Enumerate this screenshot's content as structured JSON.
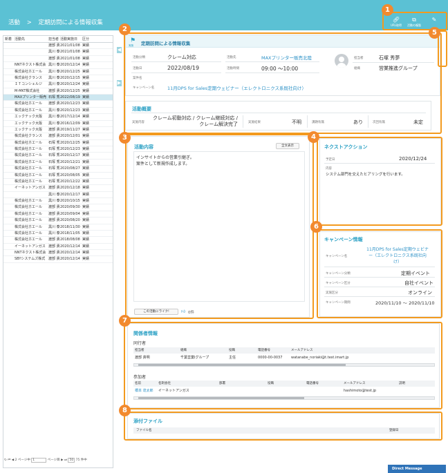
{
  "header": {
    "breadcrumb_root": "活動",
    "breadcrumb_sep": ">",
    "breadcrumb_current": "定期訪問による情報収集"
  },
  "toolbar": {
    "buttons": [
      {
        "label": "URL取得",
        "icon": "link-icon"
      },
      {
        "label": "活動の複製",
        "icon": "copy-icon"
      },
      {
        "label": "",
        "icon": "edit-icon"
      }
    ]
  },
  "callouts": [
    "1",
    "2",
    "3",
    "4",
    "5",
    "6",
    "7",
    "8"
  ],
  "list": {
    "headers": [
      "新着",
      "活動先",
      "担当者",
      "活動実施日",
      "区分"
    ],
    "rows": [
      {
        "new": "",
        "name": "",
        "person": "渡部 貴",
        "date": "2021/01/08",
        "kind": "実績"
      },
      {
        "new": "",
        "name": "",
        "person": "黒川 泰",
        "date": "2021/01/08",
        "kind": "実績"
      },
      {
        "new": "",
        "name": "",
        "person": "渡部 貴",
        "date": "2021/01/08",
        "kind": "実績"
      },
      {
        "new": "",
        "name": "NNTネクスト株式会",
        "person": "黒川 泰",
        "date": "2020/12/14",
        "kind": "実績"
      },
      {
        "new": "",
        "name": "株式会社ホエール",
        "person": "黒川 泰",
        "date": "2020/12/25",
        "kind": "実績"
      },
      {
        "new": "",
        "name": "株式会社クランス",
        "person": "黒川 泰",
        "date": "2020/12/15",
        "kind": "実績"
      },
      {
        "new": "",
        "name": "ＩＴコンシェルジ",
        "person": "黒川 泰",
        "date": "2020/12/24",
        "kind": "実績"
      },
      {
        "new": "",
        "name": "M-MKT株式会社",
        "person": "渡部 貴",
        "date": "2020/12/25",
        "kind": "実績"
      },
      {
        "new": "",
        "name": "MAXプリンター販売",
        "person": "石塚 秀",
        "date": "2022/08/19",
        "kind": "実績"
      },
      {
        "new": "",
        "name": "株式会社ホエール",
        "person": "渡部 貴",
        "date": "2020/12/23",
        "kind": "実績"
      },
      {
        "new": "",
        "name": "株式会社ホエール",
        "person": "黒川 泰",
        "date": "2020/12/23",
        "kind": "実績"
      },
      {
        "new": "",
        "name": "エックテック大阪",
        "person": "黒川 泰",
        "date": "2017/12/14",
        "kind": "実績"
      },
      {
        "new": "",
        "name": "エックテック大阪",
        "person": "黒川 泰",
        "date": "2016/12/09",
        "kind": "実績"
      },
      {
        "new": "",
        "name": "エックテック大阪",
        "person": "渡部 貴",
        "date": "2019/11/27",
        "kind": "実績"
      },
      {
        "new": "",
        "name": "株式会社クランス",
        "person": "渡部 貴",
        "date": "2020/12/01",
        "kind": "実績"
      },
      {
        "new": "",
        "name": "株式会社ホエール",
        "person": "石塚 秀",
        "date": "2020/12/25",
        "kind": "実績"
      },
      {
        "new": "",
        "name": "株式会社ホエール",
        "person": "石塚 秀",
        "date": "2020/12/23",
        "kind": "実績"
      },
      {
        "new": "",
        "name": "株式会社ホエール",
        "person": "石塚 秀",
        "date": "2020/12/17",
        "kind": "実績"
      },
      {
        "new": "",
        "name": "株式会社ホエール",
        "person": "石塚 秀",
        "date": "2020/12/21",
        "kind": "実績"
      },
      {
        "new": "",
        "name": "株式会社ホエール",
        "person": "石塚 秀",
        "date": "2020/08/27",
        "kind": "実績"
      },
      {
        "new": "",
        "name": "株式会社ホエール",
        "person": "石塚 秀",
        "date": "2020/08/05",
        "kind": "実績"
      },
      {
        "new": "",
        "name": "株式会社ホエール",
        "person": "石塚 秀",
        "date": "2020/12/22",
        "kind": "実績"
      },
      {
        "new": "",
        "name": "イーネットアンガス",
        "person": "渡部 貴",
        "date": "2020/12/18",
        "kind": "実績"
      },
      {
        "new": "",
        "name": "",
        "person": "黒川 泰",
        "date": "2020/12/17",
        "kind": "実績"
      },
      {
        "new": "",
        "name": "株式会社ホエール",
        "person": "黒川 泰",
        "date": "2020/10/15",
        "kind": "実績"
      },
      {
        "new": "",
        "name": "株式会社ホエール",
        "person": "渡部 貴",
        "date": "2020/09/30",
        "kind": "実績"
      },
      {
        "new": "",
        "name": "株式会社ホエール",
        "person": "渡部 貴",
        "date": "2020/09/04",
        "kind": "実績"
      },
      {
        "new": "",
        "name": "株式会社ホエール",
        "person": "渡部 貴",
        "date": "2020/08/20",
        "kind": "実績"
      },
      {
        "new": "",
        "name": "株式会社ホエール",
        "person": "黒川 泰",
        "date": "2018/11/30",
        "kind": "実績"
      },
      {
        "new": "",
        "name": "株式会社ホエール",
        "person": "黒川 泰",
        "date": "2018/11/05",
        "kind": "実績"
      },
      {
        "new": "",
        "name": "株式会社ホエール",
        "person": "渡部 貴",
        "date": "2018/08/08",
        "kind": "実績"
      },
      {
        "new": "",
        "name": "イーネットアンガス",
        "person": "渡部 貴",
        "date": "2020/12/14",
        "kind": "実績"
      },
      {
        "new": "",
        "name": "NNTネクスト株式会",
        "person": "渡部 貴",
        "date": "2020/12/14",
        "kind": "実績"
      },
      {
        "new": "",
        "name": "SBYシステムズ株式",
        "person": "渡部 貴",
        "date": "2020/12/14",
        "kind": "実績"
      }
    ],
    "selected_index": 8,
    "pager": {
      "first": "⏮",
      "prev": "◀",
      "page_label": "2 ページ中",
      "page_value": "1",
      "page_suffix": "ページ目",
      "next": "▶",
      "last": "⏭",
      "per_page": "50",
      "count_text": "75 件中"
    }
  },
  "activity": {
    "flag_label": "実施",
    "title": "定期訪問による情報収集",
    "fields": {
      "type_label": "活動分類",
      "type_value": "クレーム対応",
      "date_label": "活動日",
      "date_value": "2022/08/19",
      "subject_label": "案件名",
      "subject_value": "",
      "campaign_label": "キャンペーン名",
      "campaign_value": "11月DPS for Sales定期ウェビナー（エレクトロニクス系既社向け）",
      "dest_label": "活動先",
      "dest_value": "MAXプリンター販売北陸",
      "time_label": "活動時間",
      "time_value": "09:00 〜10:00",
      "owner_label": "担当者",
      "owner_value": "石塚 秀夢",
      "org_label": "組織",
      "org_value": "営業推進グループ"
    }
  },
  "summary": {
    "title": "活動概要",
    "content_label": "実施内容",
    "content_value": [
      "クレーム初動対応 / クレーム継続対応 /",
      "クレーム解決完了"
    ],
    "result_label": "実施結果",
    "result_value": "不明",
    "issue_label": "課題有無",
    "issue_value": "あり",
    "next_label": "次回有無",
    "next_value": "未定"
  },
  "content": {
    "title": "活動内容",
    "full_button": "全文表示",
    "text": [
      "インサイトからの営業引継ぎ。",
      "案件として新規作成します。"
    ],
    "like_button": "この活動にライク!",
    "like_count": "0件"
  },
  "next_action": {
    "title": "ネクストアクション",
    "due_label": "予定日",
    "due_value": "2020/12/24",
    "body_label": "内容",
    "body_value": "システム部門を交えたヒアリングを行います。"
  },
  "campaign": {
    "title": "キャンペーン情報",
    "name_label": "キャンペーン名",
    "name_value": [
      "11月DPS for Sales定期ウェビナ",
      "ー（エレクトロニクス系既社向",
      "け）"
    ],
    "type_label": "キャンペーン分類",
    "type_value": "定期イベント",
    "cls_label": "キャンペーン区分",
    "cls_value": "自社イベント",
    "method_label": "実施区分",
    "method_value": "オンライン",
    "period_label": "キャンペーン期間",
    "period_value": "2020/11/10 〜 2020/11/10"
  },
  "related": {
    "title": "関係者情報",
    "companions_title": "同行者",
    "companion_headers": [
      "担当者",
      "組織",
      "役職",
      "電話番号",
      "メールアドレス"
    ],
    "companions": [
      {
        "name": "渡部 貴明",
        "org": "千葉営業Ⅰグループ",
        "role": "主任",
        "tel": "0000-00-0037",
        "mail": "watanabe_noriaki@t.test.imart.jp"
      }
    ],
    "attendees_title": "参加者",
    "attendee_headers": [
      "名前",
      "名刺会社",
      "部署",
      "役職",
      "電話番号",
      "メールアドレス",
      "説明"
    ],
    "attendees": [
      {
        "name": "橋本 達太郎",
        "company": "イーネットアンガス",
        "dept": "",
        "role": "",
        "tel": "",
        "mail": "hashimoto@test.jp",
        "note": ""
      }
    ]
  },
  "files": {
    "title": "添付ファイル",
    "headers": [
      "ファイル名",
      "登録日"
    ]
  },
  "direct_message": "Direct Message",
  "colors": {
    "header": "#5bc1d4",
    "accent": "#2aa0c4",
    "callout": "#f28a2e",
    "selected_row": "#cde7f0"
  }
}
